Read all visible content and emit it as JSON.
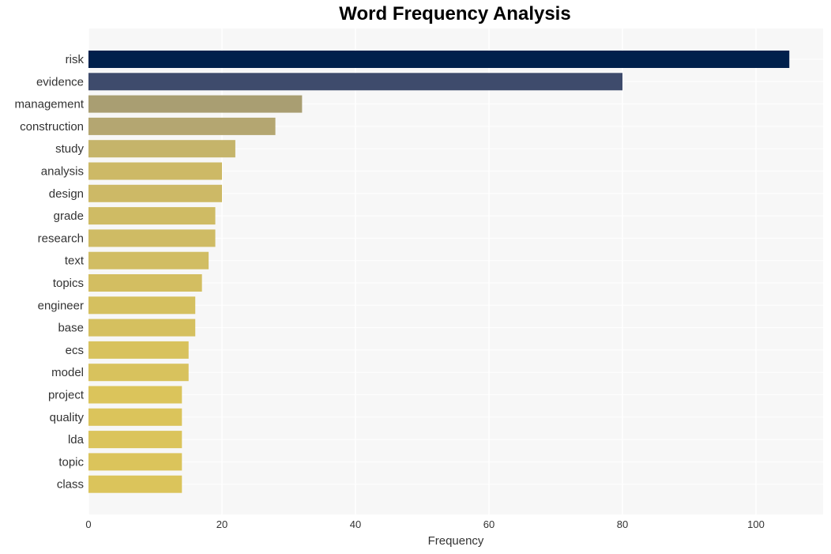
{
  "chart_data": {
    "type": "bar",
    "orientation": "horizontal",
    "title": "Word Frequency Analysis",
    "xlabel": "Frequency",
    "ylabel": "",
    "xlim": [
      0,
      110
    ],
    "xticks": [
      0,
      20,
      40,
      60,
      80,
      100
    ],
    "grid": true,
    "categories": [
      "risk",
      "evidence",
      "management",
      "construction",
      "study",
      "analysis",
      "design",
      "grade",
      "research",
      "text",
      "topics",
      "engineer",
      "base",
      "ecs",
      "model",
      "project",
      "quality",
      "lda",
      "topic",
      "class"
    ],
    "values": [
      105,
      80,
      32,
      28,
      22,
      20,
      20,
      19,
      19,
      18,
      17,
      16,
      16,
      15,
      15,
      14,
      14,
      14,
      14,
      14
    ],
    "colors": [
      "#00204c",
      "#3e4b6c",
      "#a99e72",
      "#b4a671",
      "#c5b46a",
      "#cdb966",
      "#cdb966",
      "#cfbb64",
      "#cfbb64",
      "#d1bd63",
      "#d3be61",
      "#d5c05f",
      "#d5c05f",
      "#d8c25d",
      "#d8c25d",
      "#dbc45b",
      "#dbc45b",
      "#dbc45b",
      "#dbc45b",
      "#dbc45b"
    ]
  }
}
